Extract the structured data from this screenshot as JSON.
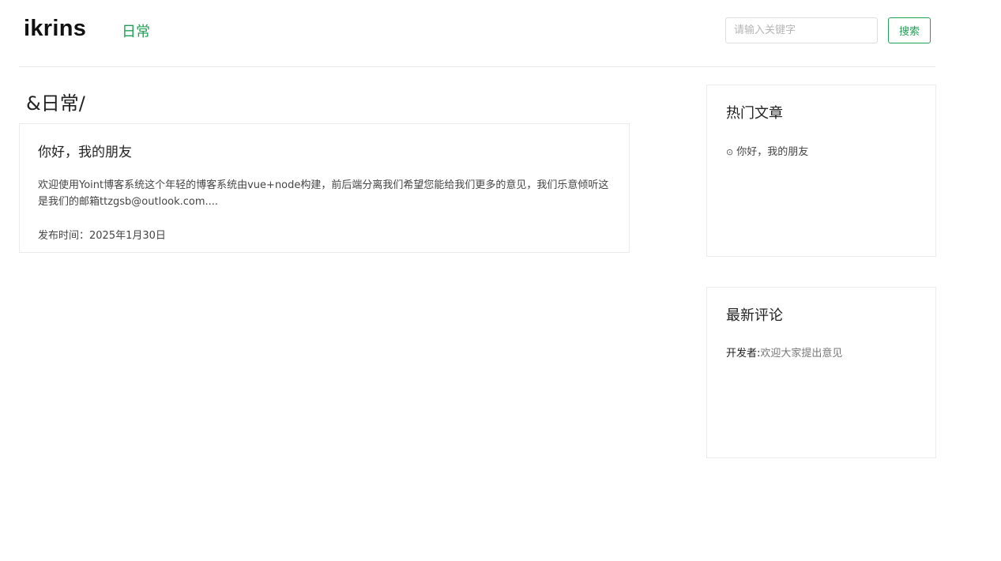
{
  "header": {
    "logo": "ikrins",
    "nav": [
      {
        "label": "日常"
      }
    ],
    "search": {
      "placeholder": "请输入关键字",
      "value": "",
      "button_label": "搜索"
    }
  },
  "main": {
    "category_title": "&日常/",
    "posts": [
      {
        "title": "你好，我的朋友",
        "excerpt": "欢迎使用Yoint博客系统这个年轻的博客系统由vue+node构建，前后端分离我们希望您能给我们更多的意见，我们乐意倾听这是我们的邮箱ttzgsb@outlook.com....",
        "date": "发布时间：2025年1月30日"
      }
    ]
  },
  "sidebar": {
    "hot_articles": {
      "title": "热门文章",
      "items": [
        {
          "bullet": "⊙",
          "label": "你好，我的朋友"
        }
      ]
    },
    "latest_comments": {
      "title": "最新评论",
      "items": [
        {
          "author": "开发者:",
          "text": "欢迎大家提出意见"
        }
      ]
    }
  },
  "colors": {
    "accent": "#21a055",
    "border": "#ebebeb",
    "text": "#333333"
  }
}
